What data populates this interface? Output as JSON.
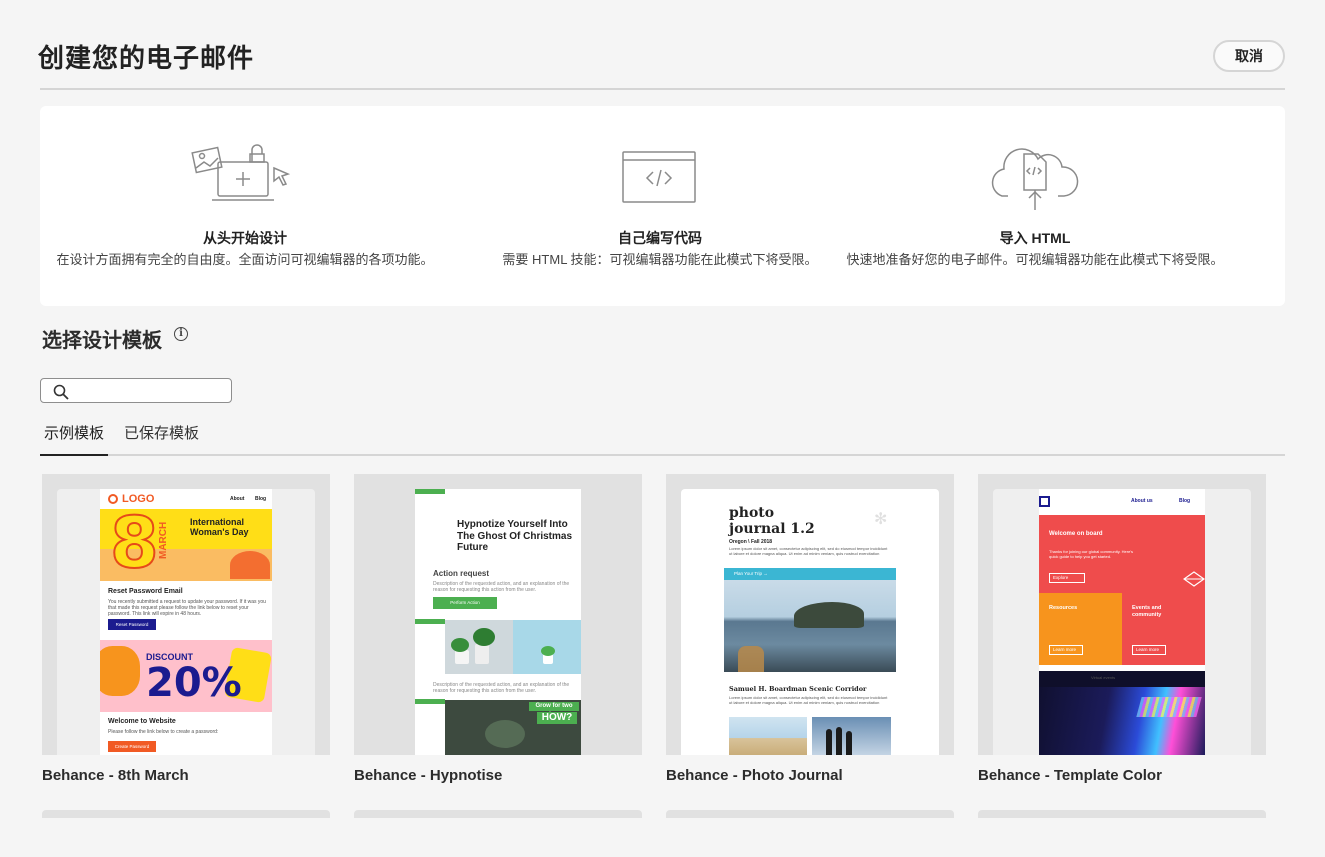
{
  "dialog": {
    "title": "创建您的电子邮件",
    "cancel_label": "取消"
  },
  "options": [
    {
      "icon": "design-from-scratch-icon",
      "title": "从头开始设计",
      "description": "在设计方面拥有完全的自由度。全面访问可视编辑器的各项功能。"
    },
    {
      "icon": "code-editor-icon",
      "title": "自己编写代码",
      "description": "需要 HTML 技能：可视编辑器功能在此模式下将受限。"
    },
    {
      "icon": "cloud-upload-icon",
      "title": "导入 HTML",
      "description": "快速地准备好您的电子邮件。可视编辑器功能在此模式下将受限。"
    }
  ],
  "templates_section": {
    "title": "选择设计模板",
    "search": {
      "value": "",
      "placeholder": ""
    },
    "tabs": [
      {
        "label": "示例模板",
        "active": true
      },
      {
        "label": "已保存模板",
        "active": false
      }
    ],
    "cards": [
      {
        "name": "Behance - 8th March"
      },
      {
        "name": "Behance - Hypnotise"
      },
      {
        "name": "Behance - Photo Journal"
      },
      {
        "name": "Behance - Template Color"
      }
    ]
  },
  "thumbnails": {
    "march": {
      "logo": "LOGO",
      "nav1": "About",
      "nav2": "Blog",
      "big_number": "8",
      "vertical": "MARCH",
      "headline": "International Woman's Day",
      "reset_title": "Reset Password Email",
      "reset_body": "You recently submitted a request to update your password. If it was you that made this request please follow the link below to reset your password. This link will expire in 48 hours.",
      "reset_button": "Reset Password",
      "discount": "DISCOUNT",
      "percent": "20%",
      "welcome_title": "Welcome to Website",
      "welcome_body": "Please follow the link below to create a password:",
      "welcome_button": "Create Password"
    },
    "hypnotise": {
      "headline": "Hypnotize Yourself Into The Ghost Of Christmas Future",
      "action_title": "Action request",
      "action_body": "Description of the requested action, and an explanation of the reason for requesting this action from the user.",
      "action_button": "Perform Action",
      "body2": "Description of the requested action, and an explanation of the reason for requesting this action from the user.",
      "banner_small": "Grow for two days",
      "banner_big": "HOW?"
    },
    "journal": {
      "title1": "photo",
      "title2": "journal 1.2",
      "subtitle": "Oregon \\ Fall 2018",
      "intro": "Lorem ipsum dolor sit amet, consectetur adipiscing elit, sed do eiusmod tempor incididunt ut labore et dolore magna aliqua. Ut enim ad minim veniam, quis nostrud exercitation",
      "plan_bar": "Plan Your Trip  →",
      "section_title": "Samuel H. Boardman Scenic Corridor",
      "section_body": "Lorem ipsum dolor sit amet, consectetur adipiscing elit, sed do eiusmod tempor incididunt ut labore et dolore magna aliqua. Ut enim ad minim veniam, quis nostrud exercitation"
    },
    "color": {
      "nav1": "About us",
      "nav2": "Blog",
      "welcome": "Welcome on board",
      "welcome_body": "Thanks for joining our global community. Here's quick guide to help you get started.",
      "explore": "Explore",
      "resources": "Resources",
      "events": "Events and community",
      "learn1": "Learn more",
      "learn2": "Learn more",
      "dark_caption": "Virtual events"
    }
  },
  "colors": {
    "accent_orange": "#f15a24",
    "yellow": "#ffde17",
    "navy": "#1b1b8f",
    "green": "#4caf50",
    "teal": "#3bb6d3",
    "red": "#ef4c4c",
    "amber": "#f7941d"
  }
}
